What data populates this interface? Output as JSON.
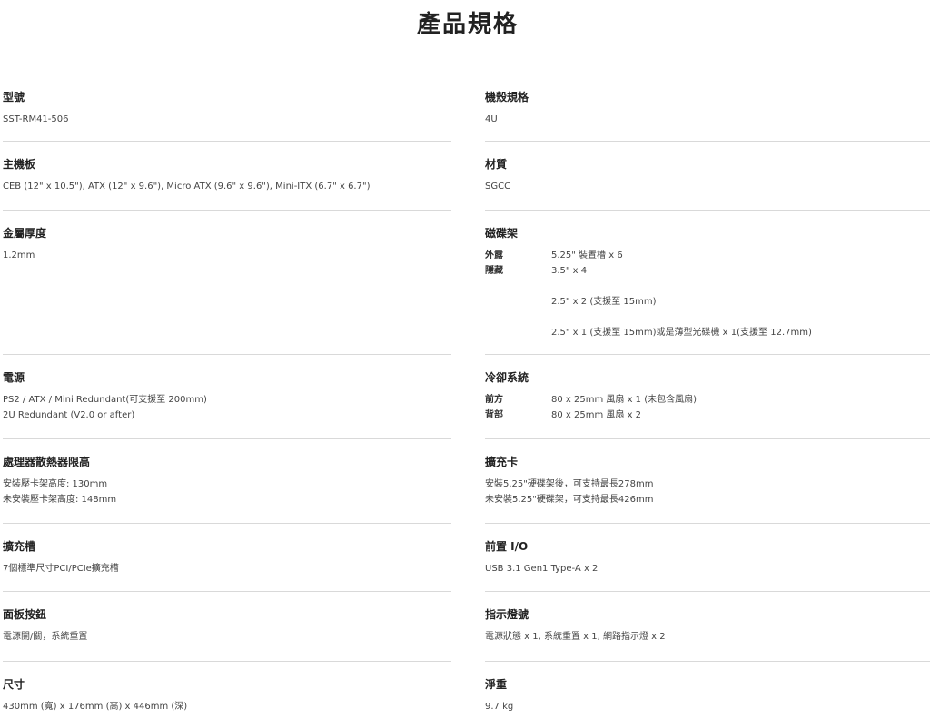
{
  "page": {
    "title": "產品規格"
  },
  "left": [
    {
      "label": "型號",
      "lines": [
        "SST-RM41-506"
      ]
    },
    {
      "label": "主機板",
      "lines": [
        "CEB (12\" x 10.5\"), ATX (12\" x 9.6\"), Micro ATX (9.6\" x 9.6\"), Mini-ITX (6.7\" x 6.7\")"
      ]
    },
    {
      "label": "金屬厚度",
      "lines": [
        "1.2mm"
      ]
    },
    {
      "label": "電源",
      "lines": [
        "PS2 / ATX / Mini Redundant(可支援至 200mm)",
        "2U Redundant (V2.0 or after)"
      ]
    },
    {
      "label": "處理器散熱器限高",
      "lines": [
        "安裝壓卡架高度: 130mm",
        "未安裝壓卡架高度: 148mm"
      ]
    },
    {
      "label": "擴充槽",
      "lines": [
        "7個標準尺寸PCI/PCIe擴充槽"
      ]
    },
    {
      "label": "面板按鈕",
      "lines": [
        "電源開/關，系統重置"
      ]
    },
    {
      "label": "尺寸",
      "lines": [
        "430mm (寬) x 176mm (高) x 446mm (深)"
      ]
    }
  ],
  "right": [
    {
      "label": "機殼規格",
      "lines": [
        "4U"
      ]
    },
    {
      "label": "材質",
      "lines": [
        "SGCC"
      ]
    },
    {
      "label": "磁碟架",
      "drive_bays": {
        "external_key": "外露",
        "external_val": "5.25\" 裝置槽 x 6",
        "internal_key": "隱藏",
        "internal_val_1": "3.5\" x 4",
        "internal_val_2": "2.5\" x 2 (支援至 15mm)",
        "internal_val_3": "2.5\" x 1 (支援至 15mm)或是薄型光碟機 x 1(支援至 12.7mm)"
      }
    },
    {
      "label": "冷卻系統",
      "cooling": {
        "front_key": "前方",
        "front_val": "80 x 25mm 風扇 x 1 (未包含風扇)",
        "rear_key": "背部",
        "rear_val": "80 x 25mm 風扇 x 2"
      }
    },
    {
      "label": "擴充卡",
      "lines": [
        "安裝5.25\"硬碟架後，可支持最長278mm",
        "未安裝5.25\"硬碟架，可支持最長426mm"
      ]
    },
    {
      "label": "前置 I/O",
      "lines": [
        "USB 3.1 Gen1 Type-A x 2"
      ]
    },
    {
      "label": "指示燈號",
      "lines": [
        "電源狀態 x 1, 系統重置 x 1, 網路指示燈 x 2"
      ]
    },
    {
      "label": "淨重",
      "lines": [
        "9.7 kg"
      ]
    }
  ]
}
